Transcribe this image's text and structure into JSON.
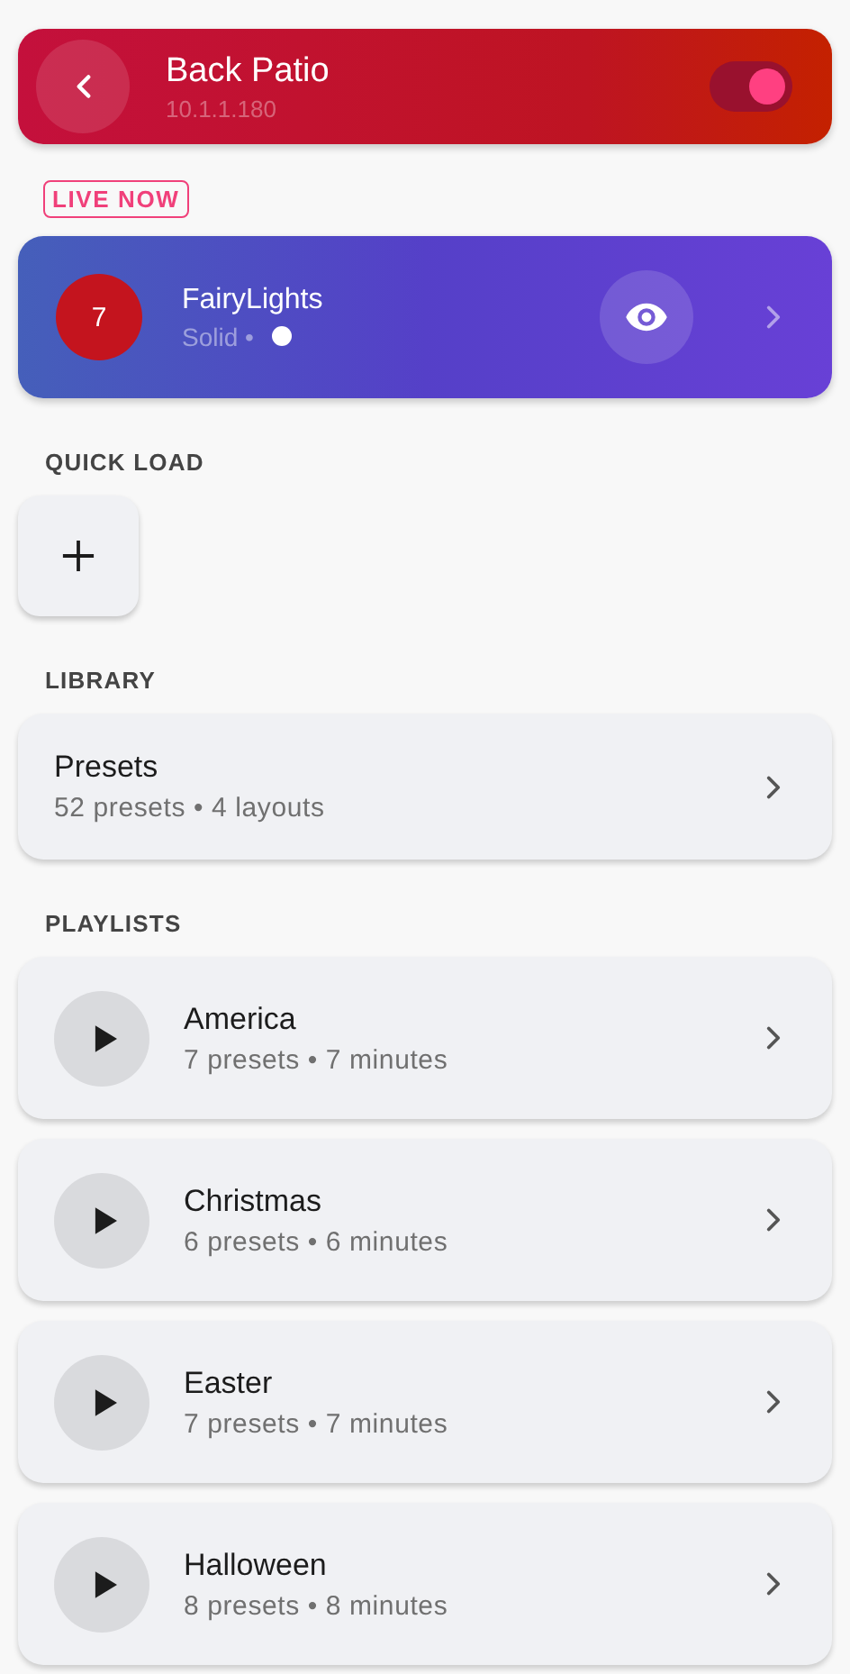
{
  "header": {
    "title": "Back Patio",
    "subtitle": "10.1.1.180",
    "power_on": true
  },
  "live": {
    "badge": "LIVE NOW",
    "number": "7",
    "name": "FairyLights",
    "effect": "Solid •",
    "color": "#ffffff"
  },
  "sections": [
    {
      "kind": "quick",
      "title": "QUICK LOAD"
    },
    {
      "kind": "library",
      "title": "LIBRARY",
      "items": [
        {
          "title": "Presets",
          "subtitle": "52 presets • 4 layouts"
        }
      ]
    },
    {
      "kind": "playlists",
      "title": "PLAYLISTS",
      "items": [
        {
          "title": "America",
          "subtitle": "7 presets • 7 minutes"
        },
        {
          "title": "Christmas",
          "subtitle": "6 presets • 6 minutes"
        },
        {
          "title": "Easter",
          "subtitle": "7 presets • 7 minutes"
        },
        {
          "title": "Halloween",
          "subtitle": "8 presets • 8 minutes"
        }
      ]
    }
  ]
}
